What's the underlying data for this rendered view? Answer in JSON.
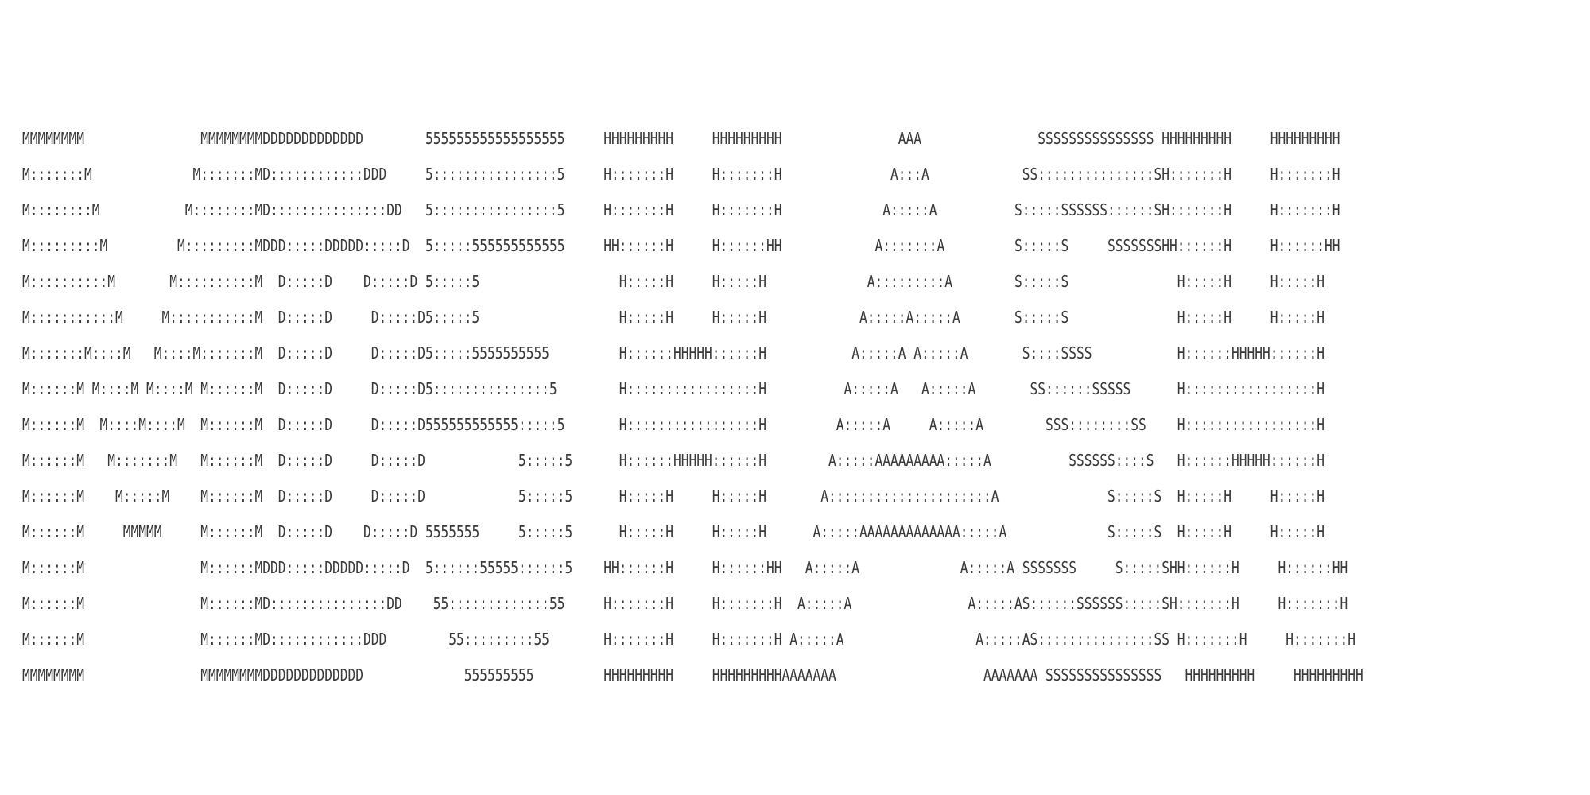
{
  "ascii_art": {
    "lines": [
      "MMMMMMMM               MMMMMMMMDDDDDDDDDDDDD        555555555555555555     HHHHHHHHH     HHHHHHHHH               AAA               SSSSSSSSSSSSSSS HHHHHHHHH     HHHHHHHHH",
      "M:::::::M             M:::::::MD::::::::::::DDD     5::::::::::::::::5     H:::::::H     H:::::::H              A:::A            SS:::::::::::::::SH:::::::H     H:::::::H",
      "M::::::::M           M::::::::MD:::::::::::::::DD   5::::::::::::::::5     H:::::::H     H:::::::H             A:::::A          S:::::SSSSSS::::::SH:::::::H     H:::::::H",
      "M:::::::::M         M:::::::::MDDD:::::DDDDD:::::D  5:::::555555555555     HH::::::H     H::::::HH            A:::::::A         S:::::S     SSSSSSSHH::::::H     H::::::HH",
      "M::::::::::M       M::::::::::M  D:::::D    D:::::D 5:::::5                  H:::::H     H:::::H             A:::::::::A        S:::::S              H:::::H     H:::::H",
      "M:::::::::::M     M:::::::::::M  D:::::D     D:::::D5:::::5                  H:::::H     H:::::H            A:::::A:::::A       S:::::S              H:::::H     H:::::H",
      "M:::::::M::::M   M::::M:::::::M  D:::::D     D:::::D5:::::5555555555         H::::::HHHHH::::::H           A:::::A A:::::A       S::::SSSS           H::::::HHHHH::::::H",
      "M::::::M M::::M M::::M M::::::M  D:::::D     D:::::D5:::::::::::::::5        H:::::::::::::::::H          A:::::A   A:::::A       SS::::::SSSSS      H:::::::::::::::::H",
      "M::::::M  M::::M::::M  M::::::M  D:::::D     D:::::D555555555555:::::5       H:::::::::::::::::H         A:::::A     A:::::A        SSS::::::::SS    H:::::::::::::::::H",
      "M::::::M   M:::::::M   M::::::M  D:::::D     D:::::D            5:::::5      H::::::HHHHH::::::H        A:::::AAAAAAAAA:::::A          SSSSSS::::S   H::::::HHHHH::::::H",
      "M::::::M    M:::::M    M::::::M  D:::::D     D:::::D            5:::::5      H:::::H     H:::::H       A:::::::::::::::::::::A              S:::::S  H:::::H     H:::::H",
      "M::::::M     MMMMM     M::::::M  D:::::D    D:::::D 5555555     5:::::5      H:::::H     H:::::H      A:::::AAAAAAAAAAAAA:::::A             S:::::S  H:::::H     H:::::H",
      "M::::::M               M::::::MDDD:::::DDDDD:::::D  5::::::55555::::::5    HH::::::H     H::::::HH   A:::::A             A:::::A SSSSSSS     S:::::SHH::::::H     H::::::HH",
      "M::::::M               M::::::MD:::::::::::::::DD    55:::::::::::::55     H:::::::H     H:::::::H  A:::::A               A:::::AS::::::SSSSSS:::::SH:::::::H     H:::::::H",
      "M::::::M               M::::::MD::::::::::::DDD        55:::::::::55       H:::::::H     H:::::::H A:::::A                 A:::::AS:::::::::::::::SS H:::::::H     H:::::::H",
      "MMMMMMMM               MMMMMMMMDDDDDDDDDDDDD             555555555         HHHHHHHHH     HHHHHHHHHAAAAAAA                   AAAAAAA SSSSSSSSSSSSSSS   HHHHHHHHH     HHHHHHHHH"
    ]
  }
}
